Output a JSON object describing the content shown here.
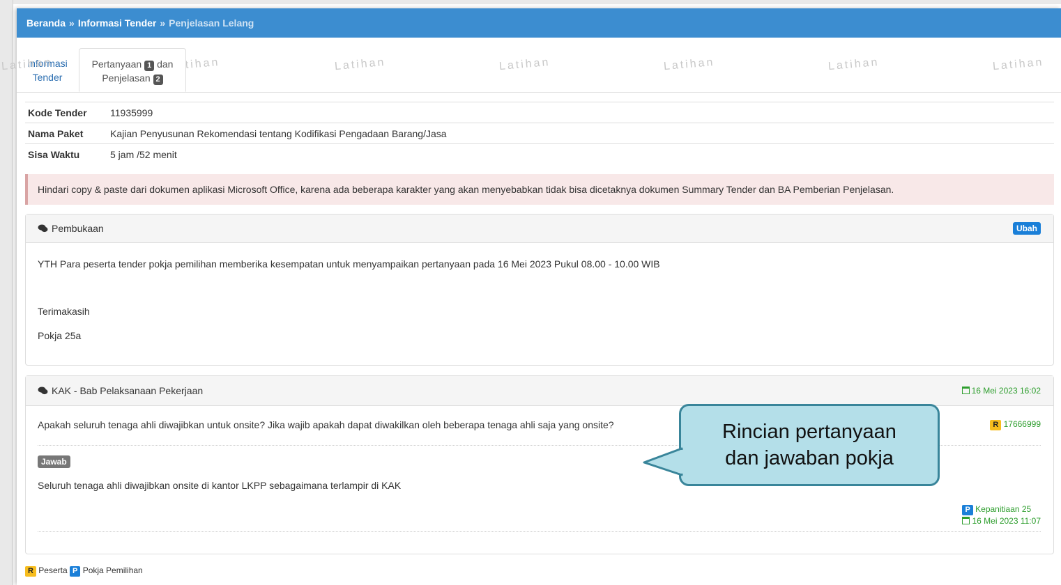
{
  "breadcrumb": {
    "home": "Beranda",
    "separator": "»",
    "tender_info": "Informasi Tender",
    "current": "Penjelasan Lelang"
  },
  "tabs": {
    "info_line1": "Informasi",
    "info_line2": "Tender",
    "qa_part1": "Pertanyaan",
    "qa_count": "1",
    "qa_part2": "dan",
    "qa_part3": "Penjelasan",
    "qa_count2": "2"
  },
  "watermark": "Latihan",
  "info": {
    "kode_label": "Kode Tender",
    "kode_value": "11935999",
    "nama_label": "Nama Paket",
    "nama_value": "Kajian Penyusunan Rekomendasi tentang Kodifikasi Pengadaan Barang/Jasa",
    "sisa_label": "Sisa Waktu",
    "sisa_value": "5 jam /52 menit"
  },
  "alert": "Hindari copy & paste dari dokumen aplikasi Microsoft Office, karena ada beberapa karakter yang akan menyebabkan tidak bisa dicetaknya dokumen Summary Tender dan BA Pemberian Penjelasan.",
  "pembukaan": {
    "title": "Pembukaan",
    "edit_label": "Ubah",
    "line1": "YTH Para peserta tender pokja pemilihan memberika kesempatan untuk menyampaikan pertanyaan pada 16 Mei 2023 Pukul 08.00 - 10.00 WIB",
    "line2": "Terimakasih",
    "line3": "Pokja 25a"
  },
  "kak": {
    "title": "KAK - Bab Pelaksanaan Pekerjaan",
    "date": "16 Mei 2023 16:02",
    "question": "Apakah seluruh tenaga ahli diwajibkan untuk onsite? Jika wajib apakah dapat diwakilkan oleh beberapa tenaga ahli saja yang onsite?",
    "asker_badge": "R",
    "asker_id": "17666999",
    "answer_label": "Jawab",
    "answer": "Seluruh tenaga ahli diwajibkan onsite di kantor LKPP sebagaimana terlampir di KAK",
    "answerer_badge": "P",
    "answerer": "Kepanitiaan 25",
    "answer_date": "16 Mei 2023 11:07"
  },
  "callout": {
    "line1": "Rincian pertanyaan",
    "line2": "dan jawaban pokja"
  },
  "legend": {
    "r_badge": "R",
    "r_label": "Peserta",
    "p_badge": "P",
    "p_label": "Pokja Pemilihan"
  },
  "colors": {
    "header_blue": "#3c8dd0",
    "alert_bg": "#f8e8e8",
    "green": "#2e9e2e",
    "badge_yellow": "#f7bd1d",
    "badge_blue": "#1a7fd8",
    "callout_bg": "#b4dfe9"
  }
}
